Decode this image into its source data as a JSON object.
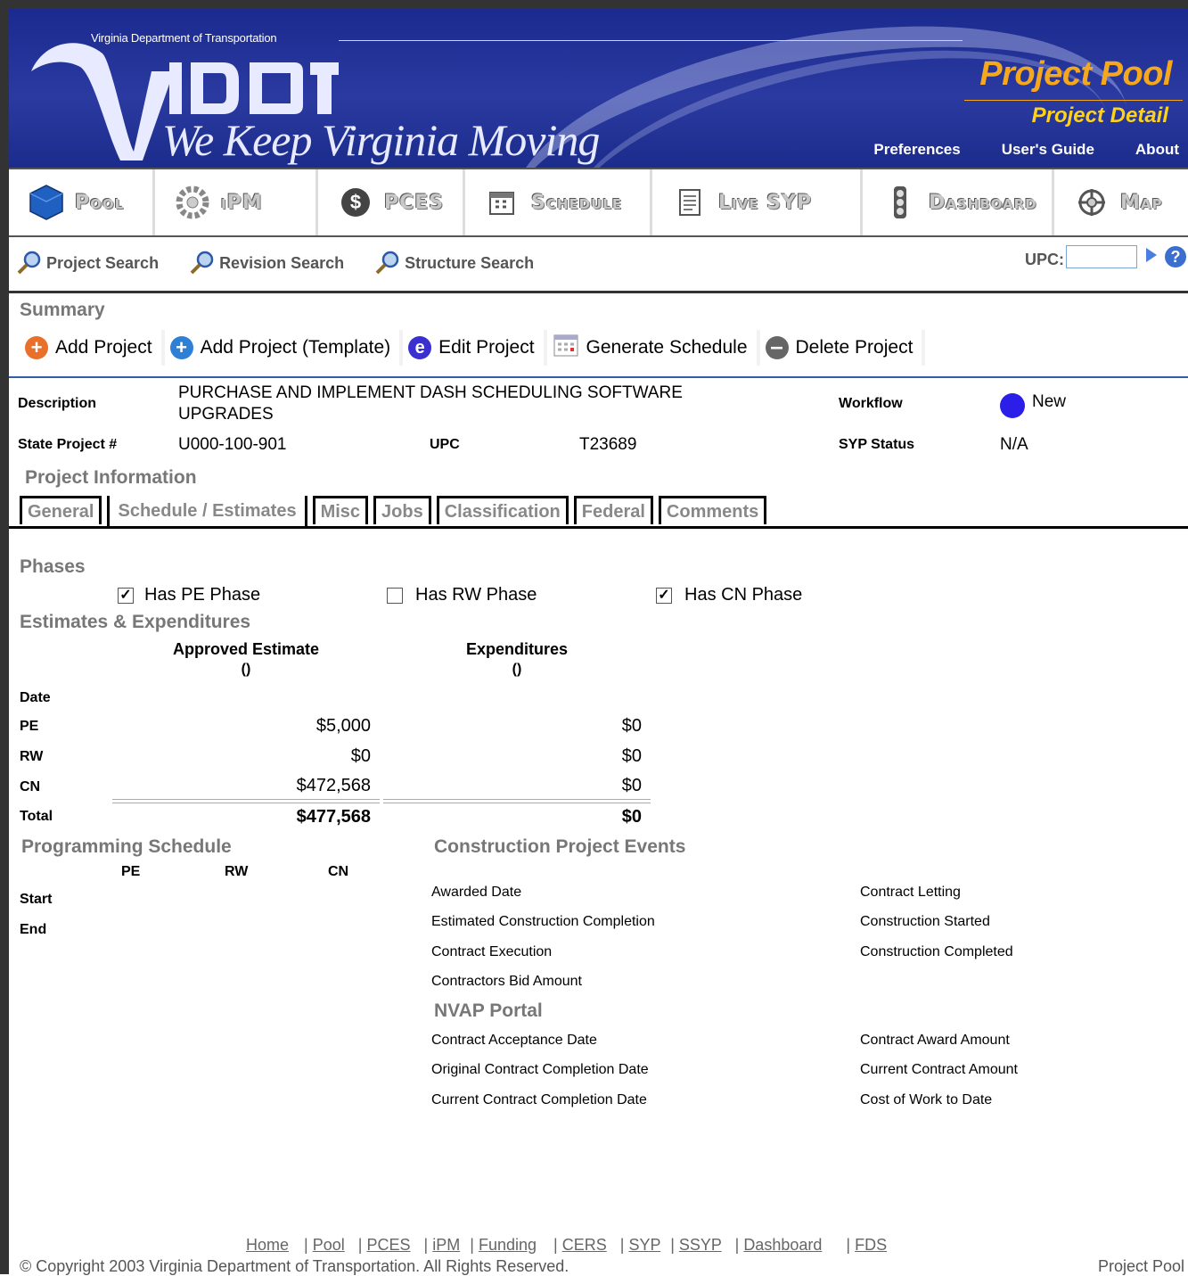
{
  "banner": {
    "org": "Virginia Department of Transportation",
    "logo_text": "VDOT",
    "slogan": "We Keep Virginia Moving",
    "app_title": "Project Pool",
    "page_title": "Project Detail",
    "links": [
      "Preferences",
      "User's Guide",
      "About"
    ]
  },
  "apps": [
    "Pool",
    "iPM",
    "PCES",
    "Schedule",
    "Live SYP",
    "Dashboard",
    "Map"
  ],
  "search": {
    "links": [
      "Project Search",
      "Revision Search",
      "Structure Search"
    ],
    "upc_label": "UPC:",
    "upc_value": ""
  },
  "summary": {
    "heading": "Summary",
    "actions": [
      "Add Project",
      "Add Project (Template)",
      "Edit Project",
      "Generate Schedule",
      "Delete Project"
    ],
    "description_label": "Description",
    "description_line1": "PURCHASE AND IMPLEMENT DASH SCHEDULING SOFTWARE",
    "description_line2": "UPGRADES",
    "workflow_label": "Workflow",
    "workflow_value": "New",
    "state_project_label": "State Project #",
    "state_project_value": "U000-100-901",
    "upc_label": "UPC",
    "upc_value": "T23689",
    "syp_status_label": "SYP Status",
    "syp_status_value": "N/A"
  },
  "project_info": {
    "heading": "Project Information",
    "tabs": [
      "General",
      "Schedule / Estimates",
      "Misc",
      "Jobs",
      "Classification",
      "Federal",
      "Comments"
    ],
    "active_tab": "Schedule / Estimates"
  },
  "phases": {
    "heading": "Phases",
    "items": [
      {
        "label": "Has PE Phase",
        "checked": true
      },
      {
        "label": "Has RW Phase",
        "checked": false
      },
      {
        "label": "Has CN Phase",
        "checked": true
      }
    ]
  },
  "estimates": {
    "heading": "Estimates & Expenditures",
    "col1": "Approved Estimate",
    "col1_sub": "()",
    "col2": "Expenditures",
    "col2_sub": "()",
    "rows": [
      {
        "label": "Date",
        "estimate": "",
        "expenditure": ""
      },
      {
        "label": "PE",
        "estimate": "$5,000",
        "expenditure": "$0"
      },
      {
        "label": "RW",
        "estimate": "$0",
        "expenditure": "$0"
      },
      {
        "label": "CN",
        "estimate": "$472,568",
        "expenditure": "$0"
      },
      {
        "label": "Total",
        "estimate": "$477,568",
        "expenditure": "$0"
      }
    ]
  },
  "programming": {
    "heading": "Programming Schedule",
    "cols": [
      "PE",
      "RW",
      "CN"
    ],
    "rows": [
      "Start",
      "End"
    ]
  },
  "construction": {
    "heading": "Construction Project Events",
    "left": [
      "Awarded Date",
      "Estimated Construction Completion",
      "Contract Execution",
      "Contractors Bid Amount"
    ],
    "right": [
      "Contract Letting",
      "Construction Started",
      "Construction Completed"
    ]
  },
  "nvap": {
    "heading": "NVAP Portal",
    "left": [
      "Contract Acceptance Date",
      "Original Contract Completion Date",
      "Current Contract Completion Date"
    ],
    "right": [
      "Contract Award Amount",
      "Current Contract Amount",
      "Cost of Work to Date"
    ]
  },
  "footer": {
    "links": [
      "Home",
      "Pool",
      "PCES",
      "iPM",
      "Funding",
      "CERS",
      "SYP",
      "SSYP",
      "Dashboard",
      "FDS"
    ],
    "copyright": "© Copyright 2003 Virginia Department of Transportation. All Rights Reserved.",
    "right": "Project Pool"
  },
  "colors": {
    "banner": "#1b2a8f",
    "accent": "#f5a71e",
    "section_heading": "#777777",
    "rule": "#2e5fa3"
  }
}
